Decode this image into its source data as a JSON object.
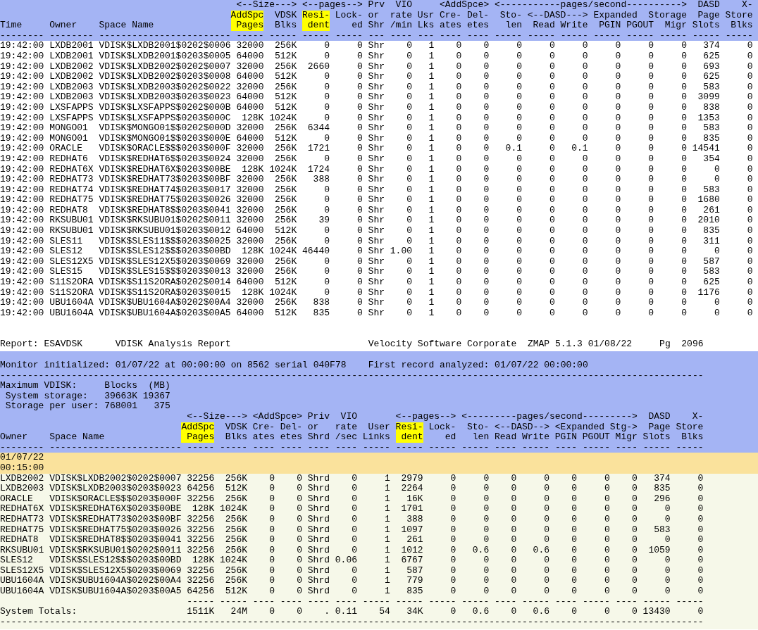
{
  "top_table": {
    "header": [
      {
        "label": [
          "Time"
        ],
        "kind": "text",
        "highlighted": false
      },
      {
        "label": [
          "Owner"
        ],
        "kind": "text",
        "highlighted": false
      },
      {
        "label": [
          "Space Name"
        ],
        "kind": "text",
        "highlighted": false
      },
      {
        "group": "<--Size--->",
        "children": [
          {
            "label": [
              "AddSpc",
              "Pages"
            ],
            "kind": "number",
            "highlighted": true
          },
          {
            "label": [
              "VDSK",
              "Blks"
            ],
            "kind": "number",
            "highlighted": false
          }
        ]
      },
      {
        "group": "<--pages-->",
        "children": [
          {
            "label": [
              "Resi-",
              "dent"
            ],
            "kind": "number",
            "highlighted": true
          },
          {
            "label": [
              "Lock-",
              "ed"
            ],
            "kind": "number",
            "highlighted": false
          }
        ]
      },
      {
        "label": [
          "Prv",
          "or",
          "Shr"
        ],
        "kind": "text",
        "highlighted": false
      },
      {
        "label": [
          "VIO",
          "rate",
          "/min"
        ],
        "kind": "number",
        "highlighted": false
      },
      {
        "label": [
          "Usr",
          "Lks"
        ],
        "kind": "number",
        "highlighted": false
      },
      {
        "group": "<AddSpce>",
        "children": [
          {
            "label": [
              "Cre-",
              "ates"
            ],
            "kind": "number",
            "highlighted": false
          },
          {
            "label": [
              "Del-",
              "etes"
            ],
            "kind": "number",
            "highlighted": false
          }
        ]
      },
      {
        "group": "<-----------pages/second---------->",
        "children": [
          {
            "label": [
              "Sto-",
              "len"
            ],
            "kind": "number",
            "highlighted": false
          },
          {
            "group": "<--DASD--->",
            "children": [
              {
                "label": [
                  "Read"
                ],
                "kind": "number",
                "highlighted": false
              },
              {
                "label": [
                  "Write"
                ],
                "kind": "number",
                "highlighted": false
              }
            ]
          },
          {
            "group": "Expanded Storage",
            "children": [
              {
                "label": [
                  "PGIN"
                ],
                "kind": "number",
                "highlighted": false
              },
              {
                "label": [
                  "PGOUT"
                ],
                "kind": "number",
                "highlighted": false
              },
              {
                "label": [
                  "Migr"
                ],
                "kind": "number",
                "highlighted": false
              }
            ]
          }
        ]
      },
      {
        "label": [
          "DASD",
          "Page",
          "Slots"
        ],
        "kind": "number",
        "highlighted": false
      },
      {
        "label": [
          "X-",
          "Store",
          "Blks"
        ],
        "kind": "number",
        "highlighted": false
      }
    ],
    "rule": "-------- -------- ------------------------ ----- ----- ----- ----- --- ---- --- ---- ---- ----- ----- ----- ----- ----- ----- ----- -----",
    "rows": [
      [
        "19:42:00",
        "LXDB2001",
        "VDISK$LXDB2001$0202$0006",
        "32000",
        "256K",
        "0",
        "0",
        "Shr",
        "0",
        "1",
        "0",
        "0",
        "0",
        "0",
        "0",
        "0",
        "0",
        "0",
        "374",
        "0"
      ],
      [
        "19:42:00",
        "LXDB2001",
        "VDISK$LXDB2001$0203$0005",
        "64000",
        "512K",
        "0",
        "0",
        "Shr",
        "0",
        "1",
        "0",
        "0",
        "0",
        "0",
        "0",
        "0",
        "0",
        "0",
        "625",
        "0"
      ],
      [
        "19:42:00",
        "LXDB2002",
        "VDISK$LXDB2002$0202$0007",
        "32000",
        "256K",
        "2660",
        "0",
        "Shr",
        "0",
        "1",
        "0",
        "0",
        "0",
        "0",
        "0",
        "0",
        "0",
        "0",
        "693",
        "0"
      ],
      [
        "19:42:00",
        "LXDB2002",
        "VDISK$LXDB2002$0203$0008",
        "64000",
        "512K",
        "0",
        "0",
        "Shr",
        "0",
        "1",
        "0",
        "0",
        "0",
        "0",
        "0",
        "0",
        "0",
        "0",
        "625",
        "0"
      ],
      [
        "19:42:00",
        "LXDB2003",
        "VDISK$LXDB2003$0202$0022",
        "32000",
        "256K",
        "0",
        "0",
        "Shr",
        "0",
        "1",
        "0",
        "0",
        "0",
        "0",
        "0",
        "0",
        "0",
        "0",
        "583",
        "0"
      ],
      [
        "19:42:00",
        "LXDB2003",
        "VDISK$LXDB2003$0203$0023",
        "64000",
        "512K",
        "0",
        "0",
        "Shr",
        "0",
        "1",
        "0",
        "0",
        "0",
        "0",
        "0",
        "0",
        "0",
        "0",
        "3099",
        "0"
      ],
      [
        "19:42:00",
        "LXSFAPPS",
        "VDISK$LXSFAPPS$0202$000B",
        "64000",
        "512K",
        "0",
        "0",
        "Shr",
        "0",
        "1",
        "0",
        "0",
        "0",
        "0",
        "0",
        "0",
        "0",
        "0",
        "838",
        "0"
      ],
      [
        "19:42:00",
        "LXSFAPPS",
        "VDISK$LXSFAPPS$0203$000C",
        "128K",
        "1024K",
        "0",
        "0",
        "Shr",
        "0",
        "1",
        "0",
        "0",
        "0",
        "0",
        "0",
        "0",
        "0",
        "0",
        "1353",
        "0"
      ],
      [
        "19:42:00",
        "MONGO01",
        "VDISK$MONGO01$$0202$000D",
        "32000",
        "256K",
        "6344",
        "0",
        "Shr",
        "0",
        "1",
        "0",
        "0",
        "0",
        "0",
        "0",
        "0",
        "0",
        "0",
        "583",
        "0"
      ],
      [
        "19:42:00",
        "MONGO01",
        "VDISK$MONGO01$$0203$000E",
        "64000",
        "512K",
        "0",
        "0",
        "Shr",
        "0",
        "1",
        "0",
        "0",
        "0",
        "0",
        "0",
        "0",
        "0",
        "0",
        "835",
        "0"
      ],
      [
        "19:42:00",
        "ORACLE",
        "VDISK$ORACLE$$$0203$000F",
        "32000",
        "256K",
        "1721",
        "0",
        "Shr",
        "0",
        "1",
        "0",
        "0",
        "0.1",
        "0",
        "0.1",
        "0",
        "0",
        "0",
        "14541",
        "0"
      ],
      [
        "19:42:00",
        "REDHAT6",
        "VDISK$REDHAT6$$0203$0024",
        "32000",
        "256K",
        "0",
        "0",
        "Shr",
        "0",
        "1",
        "0",
        "0",
        "0",
        "0",
        "0",
        "0",
        "0",
        "0",
        "354",
        "0"
      ],
      [
        "19:42:00",
        "REDHAT6X",
        "VDISK$REDHAT6X$0203$00BE",
        "128K",
        "1024K",
        "1724",
        "0",
        "Shr",
        "0",
        "1",
        "0",
        "0",
        "0",
        "0",
        "0",
        "0",
        "0",
        "0",
        "0",
        "0"
      ],
      [
        "19:42:00",
        "REDHAT73",
        "VDISK$REDHAT73$0203$00BF",
        "32000",
        "256K",
        "388",
        "0",
        "Shr",
        "0",
        "1",
        "0",
        "0",
        "0",
        "0",
        "0",
        "0",
        "0",
        "0",
        "0",
        "0"
      ],
      [
        "19:42:00",
        "REDHAT74",
        "VDISK$REDHAT74$0203$0017",
        "32000",
        "256K",
        "0",
        "0",
        "Shr",
        "0",
        "1",
        "0",
        "0",
        "0",
        "0",
        "0",
        "0",
        "0",
        "0",
        "583",
        "0"
      ],
      [
        "19:42:00",
        "REDHAT75",
        "VDISK$REDHAT75$0203$0026",
        "32000",
        "256K",
        "0",
        "0",
        "Shr",
        "0",
        "1",
        "0",
        "0",
        "0",
        "0",
        "0",
        "0",
        "0",
        "0",
        "1680",
        "0"
      ],
      [
        "19:42:00",
        "REDHAT8",
        "VDISK$REDHAT8$$0203$0041",
        "32000",
        "256K",
        "0",
        "0",
        "Shr",
        "0",
        "1",
        "0",
        "0",
        "0",
        "0",
        "0",
        "0",
        "0",
        "0",
        "261",
        "0"
      ],
      [
        "19:42:00",
        "RKSUBU01",
        "VDISK$RKSUBU01$0202$0011",
        "32000",
        "256K",
        "39",
        "0",
        "Shr",
        "0",
        "1",
        "0",
        "0",
        "0",
        "0",
        "0",
        "0",
        "0",
        "0",
        "2010",
        "0"
      ],
      [
        "19:42:00",
        "RKSUBU01",
        "VDISK$RKSUBU01$0203$0012",
        "64000",
        "512K",
        "0",
        "0",
        "Shr",
        "0",
        "1",
        "0",
        "0",
        "0",
        "0",
        "0",
        "0",
        "0",
        "0",
        "835",
        "0"
      ],
      [
        "19:42:00",
        "SLES11",
        "VDISK$SLES11$$$0203$0025",
        "32000",
        "256K",
        "0",
        "0",
        "Shr",
        "0",
        "1",
        "0",
        "0",
        "0",
        "0",
        "0",
        "0",
        "0",
        "0",
        "311",
        "0"
      ],
      [
        "19:42:00",
        "SLES12",
        "VDISK$SLES12$$$0203$00BD",
        "128K",
        "1024K",
        "46440",
        "0",
        "Shr",
        "1.00",
        "1",
        "0",
        "0",
        "0",
        "0",
        "0",
        "0",
        "0",
        "0",
        "0",
        "0"
      ],
      [
        "19:42:00",
        "SLES12X5",
        "VDISK$SLES12X5$0203$0069",
        "32000",
        "256K",
        "0",
        "0",
        "Shr",
        "0",
        "1",
        "0",
        "0",
        "0",
        "0",
        "0",
        "0",
        "0",
        "0",
        "587",
        "0"
      ],
      [
        "19:42:00",
        "SLES15",
        "VDISK$SLES15$$$0203$0013",
        "32000",
        "256K",
        "0",
        "0",
        "Shr",
        "0",
        "1",
        "0",
        "0",
        "0",
        "0",
        "0",
        "0",
        "0",
        "0",
        "583",
        "0"
      ],
      [
        "19:42:00",
        "S11S2ORA",
        "VDISK$S11S2ORA$0202$0014",
        "64000",
        "512K",
        "0",
        "0",
        "Shr",
        "0",
        "1",
        "0",
        "0",
        "0",
        "0",
        "0",
        "0",
        "0",
        "0",
        "625",
        "0"
      ],
      [
        "19:42:00",
        "S11S2ORA",
        "VDISK$S11S2ORA$0203$0015",
        "128K",
        "1024K",
        "0",
        "0",
        "Shr",
        "0",
        "1",
        "0",
        "0",
        "0",
        "0",
        "0",
        "0",
        "0",
        "0",
        "1176",
        "0"
      ],
      [
        "19:42:00",
        "UBU1604A",
        "VDISK$UBU1604A$0202$00A4",
        "32000",
        "256K",
        "838",
        "0",
        "Shr",
        "0",
        "1",
        "0",
        "0",
        "0",
        "0",
        "0",
        "0",
        "0",
        "0",
        "0",
        "0"
      ],
      [
        "19:42:00",
        "UBU1604A",
        "VDISK$UBU1604A$0203$00A5",
        "64000",
        "512K",
        "835",
        "0",
        "Shr",
        "0",
        "1",
        "0",
        "0",
        "0",
        "0",
        "0",
        "0",
        "0",
        "0",
        "0",
        "0"
      ]
    ]
  },
  "report_header": {
    "report": "Report: ESAVDSK",
    "title": "VDISK Analysis Report",
    "company": "Velocity Software Corporate",
    "product": "ZMAP 5.1.3 01/08/22",
    "page_label": "Pg",
    "page_number": "2096"
  },
  "monitor": {
    "initialized": "Monitor initialized: 01/07/22 at 00:00:00 on 8562 serial 040F78",
    "first_record": "First record analyzed: 01/07/22 00:00:00",
    "rule": "--------------------------------------------------------------------------------------------------------------------------------"
  },
  "max_vdisk": [
    {
      "kind": "heading",
      "cells": [
        "Maximum VDISK:",
        "Blocks",
        "(MB)"
      ]
    },
    {
      "kind": "value",
      "cells": [
        "System storage:",
        "39663K",
        "19367"
      ]
    },
    {
      "kind": "value",
      "cells": [
        "Storage per user:",
        "768001",
        "375"
      ]
    }
  ],
  "bottom_table": {
    "header": [
      {
        "label": [
          "Owner"
        ],
        "kind": "text",
        "highlighted": false
      },
      {
        "label": [
          "Space Name"
        ],
        "kind": "text",
        "highlighted": false
      },
      {
        "group": "<--Size--->",
        "children": [
          {
            "label": [
              "AddSpc",
              "Pages"
            ],
            "kind": "number",
            "highlighted": true
          },
          {
            "label": [
              "VDSK",
              "Blks"
            ],
            "kind": "number",
            "highlighted": false
          }
        ]
      },
      {
        "group": "<AddSpce>",
        "children": [
          {
            "label": [
              "Cre-",
              "ates"
            ],
            "kind": "number",
            "highlighted": false
          },
          {
            "label": [
              "Del-",
              "etes"
            ],
            "kind": "number",
            "highlighted": false
          }
        ]
      },
      {
        "label": [
          "Priv",
          "or",
          "Shrd"
        ],
        "kind": "text",
        "highlighted": false
      },
      {
        "label": [
          "VIO",
          "rate",
          "/sec"
        ],
        "kind": "number",
        "highlighted": false
      },
      {
        "label": [
          "User",
          "Links"
        ],
        "kind": "number",
        "highlighted": false
      },
      {
        "group": "<--pages-->",
        "children": [
          {
            "label": [
              "Resi-",
              "dent"
            ],
            "kind": "number",
            "highlighted": true
          },
          {
            "label": [
              "Lock-",
              "ed"
            ],
            "kind": "number",
            "highlighted": false
          }
        ]
      },
      {
        "group": "<---------pages/second--------->",
        "children": [
          {
            "label": [
              "Sto-",
              "len"
            ],
            "kind": "number",
            "highlighted": false
          },
          {
            "group": "<--DASD-->",
            "children": [
              {
                "label": [
                  "Read"
                ],
                "kind": "number",
                "highlighted": false
              },
              {
                "label": [
                  "Write"
                ],
                "kind": "number",
                "highlighted": false
              }
            ]
          },
          {
            "group": "<Expanded Stg->",
            "children": [
              {
                "label": [
                  "PGIN"
                ],
                "kind": "number",
                "highlighted": false
              },
              {
                "label": [
                  "PGOUT"
                ],
                "kind": "number",
                "highlighted": false
              },
              {
                "label": [
                  "Migr"
                ],
                "kind": "number",
                "highlighted": false
              }
            ]
          }
        ]
      },
      {
        "label": [
          "DASD",
          "Page",
          "Slots"
        ],
        "kind": "number",
        "highlighted": false
      },
      {
        "label": [
          "X-",
          "Store",
          "Blks"
        ],
        "kind": "number",
        "highlighted": false
      }
    ],
    "rule": "-------- ------------------------ ----- ----- ---- ---- ---- ---- ----- ----- ----- ----- ---- ----- ---- ----- ---- ----- -----",
    "interval": {
      "date": "01/07/22",
      "time": "00:15:00"
    },
    "rows": [
      [
        "LXDB2002",
        "VDISK$LXDB2002$0202$0007",
        "32256",
        "256K",
        "0",
        "0",
        "Shrd",
        "0",
        "1",
        "2979",
        "0",
        "0",
        "0",
        "0",
        "0",
        "0",
        "0",
        "374",
        "0"
      ],
      [
        "LXDB2003",
        "VDISK$LXDB2003$0203$0023",
        "64256",
        "512K",
        "0",
        "0",
        "Shrd",
        "0",
        "1",
        "2264",
        "0",
        "0",
        "0",
        "0",
        "0",
        "0",
        "0",
        "835",
        "0"
      ],
      [
        "ORACLE",
        "VDISK$ORACLE$$$0203$000F",
        "32256",
        "256K",
        "0",
        "0",
        "Shrd",
        "0",
        "1",
        "16K",
        "0",
        "0",
        "0",
        "0",
        "0",
        "0",
        "0",
        "296",
        "0"
      ],
      [
        "REDHAT6X",
        "VDISK$REDHAT6X$0203$00BE",
        "128K",
        "1024K",
        "0",
        "0",
        "Shrd",
        "0",
        "1",
        "1701",
        "0",
        "0",
        "0",
        "0",
        "0",
        "0",
        "0",
        "0",
        "0"
      ],
      [
        "REDHAT73",
        "VDISK$REDHAT73$0203$00BF",
        "32256",
        "256K",
        "0",
        "0",
        "Shrd",
        "0",
        "1",
        "388",
        "0",
        "0",
        "0",
        "0",
        "0",
        "0",
        "0",
        "0",
        "0"
      ],
      [
        "REDHAT75",
        "VDISK$REDHAT75$0203$0026",
        "32256",
        "256K",
        "0",
        "0",
        "Shrd",
        "0",
        "1",
        "1097",
        "0",
        "0",
        "0",
        "0",
        "0",
        "0",
        "0",
        "583",
        "0"
      ],
      [
        "REDHAT8",
        "VDISK$REDHAT8$$0203$0041",
        "32256",
        "256K",
        "0",
        "0",
        "Shrd",
        "0",
        "1",
        "261",
        "0",
        "0",
        "0",
        "0",
        "0",
        "0",
        "0",
        "0",
        "0"
      ],
      [
        "RKSUBU01",
        "VDISK$RKSUBU01$0202$0011",
        "32256",
        "256K",
        "0",
        "0",
        "Shrd",
        "0",
        "1",
        "1012",
        "0",
        "0.6",
        "0",
        "0.6",
        "0",
        "0",
        "0",
        "1059",
        "0"
      ],
      [
        "SLES12",
        "VDISK$SLES12$$$0203$00BD",
        "128K",
        "1024K",
        "0",
        "0",
        "Shrd",
        "0.06",
        "1",
        "6767",
        "0",
        "0",
        "0",
        "0",
        "0",
        "0",
        "0",
        "0",
        "0"
      ],
      [
        "SLES12X5",
        "VDISK$SLES12X5$0203$0069",
        "32256",
        "256K",
        "0",
        "0",
        "Shrd",
        "0",
        "1",
        "587",
        "0",
        "0",
        "0",
        "0",
        "0",
        "0",
        "0",
        "0",
        "0"
      ],
      [
        "UBU1604A",
        "VDISK$UBU1604A$0202$00A4",
        "32256",
        "256K",
        "0",
        "0",
        "Shrd",
        "0",
        "1",
        "779",
        "0",
        "0",
        "0",
        "0",
        "0",
        "0",
        "0",
        "0",
        "0"
      ],
      [
        "UBU1604A",
        "VDISK$UBU1604A$0203$00A5",
        "64256",
        "512K",
        "0",
        "0",
        "Shrd",
        "0",
        "1",
        "835",
        "0",
        "0",
        "0",
        "0",
        "0",
        "0",
        "0",
        "0",
        "0"
      ]
    ],
    "totals_rule": "----- ----- ---- ---- ---- ---- ----- ----- ----- ----- ---- ----- ---- ----- ---- ----- -----",
    "totals": {
      "label": "System Totals:",
      "cells": [
        "1511K",
        "24M",
        "0",
        "0",
        ".",
        "0.11",
        "54",
        "34K",
        "0",
        "0.6",
        "0",
        "0.6",
        "0",
        "0",
        "0",
        "13430",
        "0"
      ]
    },
    "end_rule": "--------------------------------------------------------------------------------------------------------------------------------"
  }
}
